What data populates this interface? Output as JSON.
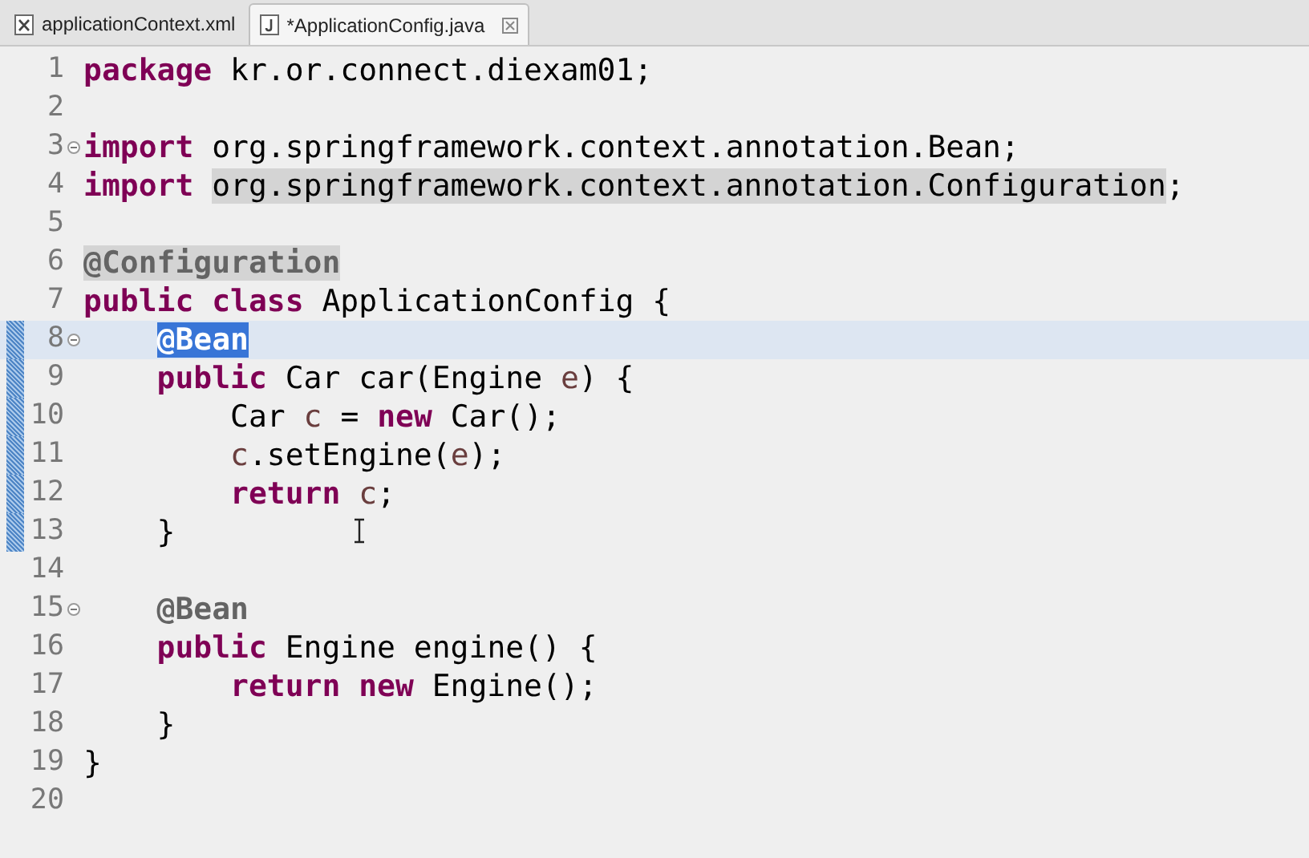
{
  "tabs": [
    {
      "label": "applicationContext.xml",
      "kind": "xml",
      "selected": false,
      "closable": false
    },
    {
      "label": "*ApplicationConfig.java",
      "kind": "java",
      "selected": true,
      "closable": true
    }
  ],
  "editor": {
    "lines": [
      {
        "number": "1",
        "fold": false,
        "changed": false,
        "current": false,
        "tokens": [
          {
            "text": "package",
            "kind": "keyword"
          },
          {
            "text": " kr.or.connect.diexam01;",
            "kind": "plain"
          }
        ]
      },
      {
        "number": "2",
        "fold": false,
        "changed": false,
        "current": false
      },
      {
        "number": "3",
        "fold": true,
        "changed": false,
        "current": false,
        "tokens": [
          {
            "text": "import",
            "kind": "keyword"
          },
          {
            "text": " org.springframework.context.annotation.Bean;",
            "kind": "plain"
          }
        ]
      },
      {
        "number": "4",
        "fold": false,
        "changed": false,
        "current": false,
        "tokens": [
          {
            "text": "import ",
            "kind": "keyword"
          },
          {
            "text": "org.springframework.context.annotation.Configuration",
            "kind": "plain",
            "occurrence": true
          },
          {
            "text": ";",
            "kind": "plain"
          }
        ]
      },
      {
        "number": "5",
        "fold": false,
        "changed": false,
        "current": false
      },
      {
        "number": "6",
        "fold": false,
        "changed": false,
        "current": false,
        "tokens": [
          {
            "text": "@Configuration",
            "kind": "annotation",
            "occurrence": true
          }
        ]
      },
      {
        "number": "7",
        "fold": false,
        "changed": false,
        "current": false,
        "tokens": [
          {
            "text": "public class",
            "kind": "keyword"
          },
          {
            "text": " ApplicationConfig {",
            "kind": "plain"
          }
        ]
      },
      {
        "number": "8",
        "fold": true,
        "changed": true,
        "current": true,
        "tokens": [
          {
            "text": "    @Bean",
            "kind": "annotation",
            "selected": true
          }
        ]
      },
      {
        "number": "9",
        "fold": false,
        "changed": true,
        "current": false,
        "tokens": [
          {
            "text": "    public",
            "kind": "keyword"
          },
          {
            "text": " Car car(Engine ",
            "kind": "plain"
          },
          {
            "text": "e",
            "kind": "variable"
          },
          {
            "text": ") {",
            "kind": "plain"
          }
        ]
      },
      {
        "number": "10",
        "fold": false,
        "changed": true,
        "current": false,
        "tokens": [
          {
            "text": "        Car ",
            "kind": "plain"
          },
          {
            "text": "c",
            "kind": "variable"
          },
          {
            "text": " = ",
            "kind": "plain"
          },
          {
            "text": "new",
            "kind": "keyword"
          },
          {
            "text": " Car();",
            "kind": "plain"
          }
        ]
      },
      {
        "number": "11",
        "fold": false,
        "changed": true,
        "current": false,
        "tokens": [
          {
            "text": "        c",
            "kind": "variable"
          },
          {
            "text": ".setEngine(",
            "kind": "plain"
          },
          {
            "text": "e",
            "kind": "variable"
          },
          {
            "text": ");",
            "kind": "plain"
          }
        ]
      },
      {
        "number": "12",
        "fold": false,
        "changed": true,
        "current": false,
        "tokens": [
          {
            "text": "        return ",
            "kind": "keyword"
          },
          {
            "text": "c",
            "kind": "variable"
          },
          {
            "text": ";",
            "kind": "plain"
          }
        ]
      },
      {
        "number": "13",
        "fold": false,
        "changed": true,
        "current": false,
        "tokens": [
          {
            "text": "    }",
            "kind": "plain"
          }
        ]
      },
      {
        "number": "14",
        "fold": false,
        "changed": false,
        "current": false
      },
      {
        "number": "15",
        "fold": true,
        "changed": false,
        "current": false,
        "tokens": [
          {
            "text": "    @Bean",
            "kind": "annotation"
          }
        ]
      },
      {
        "number": "16",
        "fold": false,
        "changed": false,
        "current": false,
        "tokens": [
          {
            "text": "    public",
            "kind": "keyword"
          },
          {
            "text": " Engine engine() {",
            "kind": "plain"
          }
        ]
      },
      {
        "number": "17",
        "fold": false,
        "changed": false,
        "current": false,
        "tokens": [
          {
            "text": "        return new",
            "kind": "keyword"
          },
          {
            "text": " Engine();",
            "kind": "plain"
          }
        ]
      },
      {
        "number": "18",
        "fold": false,
        "changed": false,
        "current": false,
        "tokens": [
          {
            "text": "    }",
            "kind": "plain"
          }
        ]
      },
      {
        "number": "19",
        "fold": false,
        "changed": false,
        "current": false,
        "tokens": [
          {
            "text": "}",
            "kind": "plain"
          }
        ]
      },
      {
        "number": "20",
        "fold": false,
        "changed": false,
        "current": false
      }
    ]
  }
}
